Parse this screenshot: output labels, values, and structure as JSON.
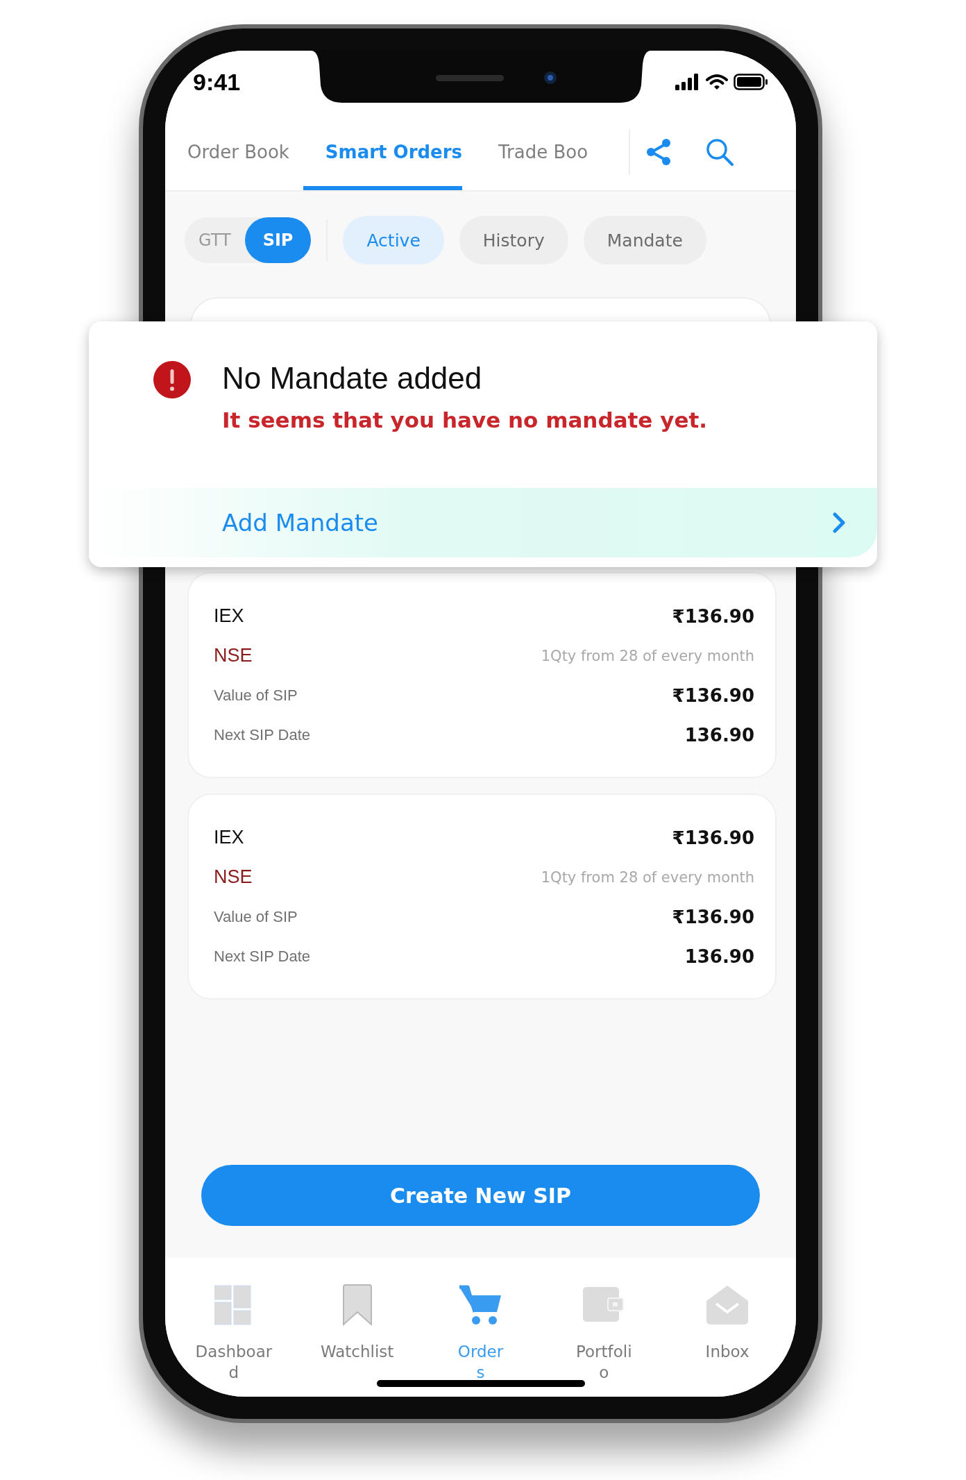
{
  "status_bar": {
    "time": "9:41"
  },
  "tabs": [
    {
      "label": "Order Book",
      "selected": false
    },
    {
      "label": "Smart Orders",
      "selected": true
    },
    {
      "label": "Trade Boo",
      "selected": false
    }
  ],
  "segmented": [
    {
      "label": "GTT",
      "selected": false
    },
    {
      "label": "SIP",
      "selected": true
    }
  ],
  "filters": [
    {
      "label": "Active",
      "selected": true
    },
    {
      "label": "History",
      "selected": false
    },
    {
      "label": "Mandate",
      "selected": false
    }
  ],
  "alert": {
    "title": "No Mandate added",
    "message": "It seems that you have no mandate yet.",
    "action": "Add Mandate"
  },
  "sips": [
    {
      "symbol": "IEX",
      "price": "₹136.90",
      "exchange": "NSE",
      "schedule": "1Qty from 28 of every month",
      "value_label": "Value of SIP",
      "value": "₹136.90",
      "date_label": "Next SIP Date",
      "date": "136.90"
    },
    {
      "symbol": "IEX",
      "price": "₹136.90",
      "exchange": "NSE",
      "schedule": "1Qty from 28 of every month",
      "value_label": "Value of SIP",
      "value": "₹136.90",
      "date_label": "Next SIP Date",
      "date": "136.90"
    }
  ],
  "create_button": "Create New SIP",
  "nav": [
    {
      "label": "Dashboar\nd",
      "kind": "dashboard",
      "selected": false
    },
    {
      "label": "Watchlist",
      "kind": "bookmark",
      "selected": false
    },
    {
      "label": "Order\ns",
      "kind": "cart",
      "selected": true
    },
    {
      "label": "Portfoli\no",
      "kind": "wallet",
      "selected": false
    },
    {
      "label": "Inbox",
      "kind": "mail",
      "selected": false
    }
  ]
}
